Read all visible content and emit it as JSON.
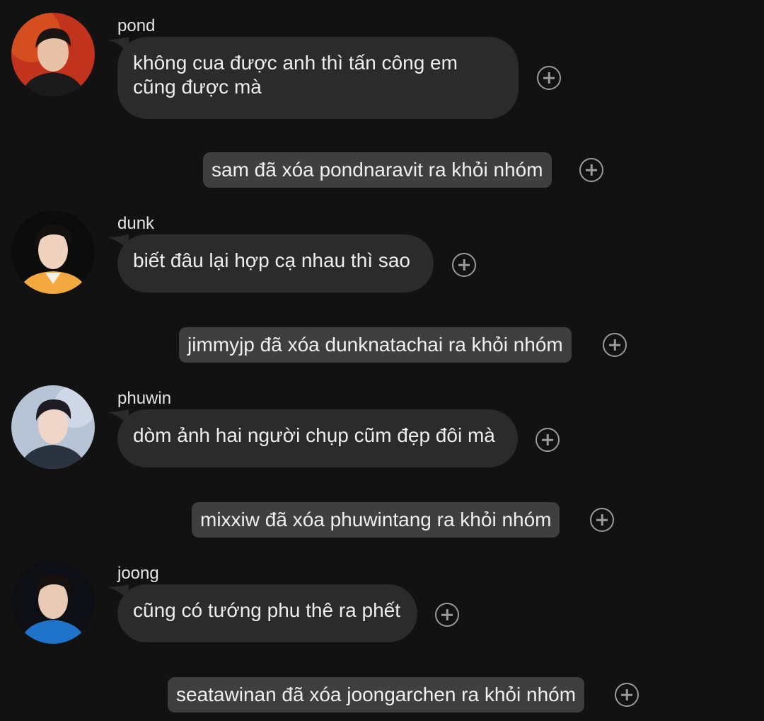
{
  "messages": [
    {
      "sender": "pond",
      "text": "không cua được anh thì tấn công em cũng được mà",
      "avatar": "avatar-pond",
      "avatar_colors": {
        "bg": "#c2331e",
        "skin": "#e8c2a6",
        "hair": "#1b1511",
        "shirt": "#1a1a1a"
      }
    },
    {
      "sender": "dunk",
      "text": "biết đâu lại hợp cạ nhau thì sao",
      "avatar": "avatar-dunk",
      "avatar_colors": {
        "bg": "#0c0c0c",
        "skin": "#f0d2bf",
        "hair": "#15110f",
        "shirt": "#f3a940"
      }
    },
    {
      "sender": "phuwin",
      "text": "dòm ảnh hai người chụp cũm đẹp đôi mà",
      "avatar": "avatar-phuwin",
      "avatar_colors": {
        "bg": "#b7c4d6",
        "skin": "#efd6c8",
        "hair": "#1f1b22",
        "shirt": "#2c3340"
      }
    },
    {
      "sender": "joong",
      "text": "cũng có tướng phu thê ra phết",
      "avatar": "avatar-joong",
      "avatar_colors": {
        "bg": "#0d0f14",
        "skin": "#e7c9b4",
        "hair": "#17120f",
        "shirt": "#1e73c8"
      }
    }
  ],
  "system_notices": [
    "sam đã xóa pondnaravit ra khỏi nhóm",
    "jimmyjp đã xóa dunknatachai ra khỏi nhóm",
    "mixxiw đã xóa phuwintang ra khỏi nhóm",
    "seatawinan đã xóa joongarchen ra khỏi nhóm"
  ],
  "icons": {
    "react": "add-reaction-icon"
  },
  "colors": {
    "background": "#121212",
    "bubble": "#2b2b2b",
    "system_bubble": "#3f3f3f",
    "react_icon": "#9a9a9a"
  }
}
